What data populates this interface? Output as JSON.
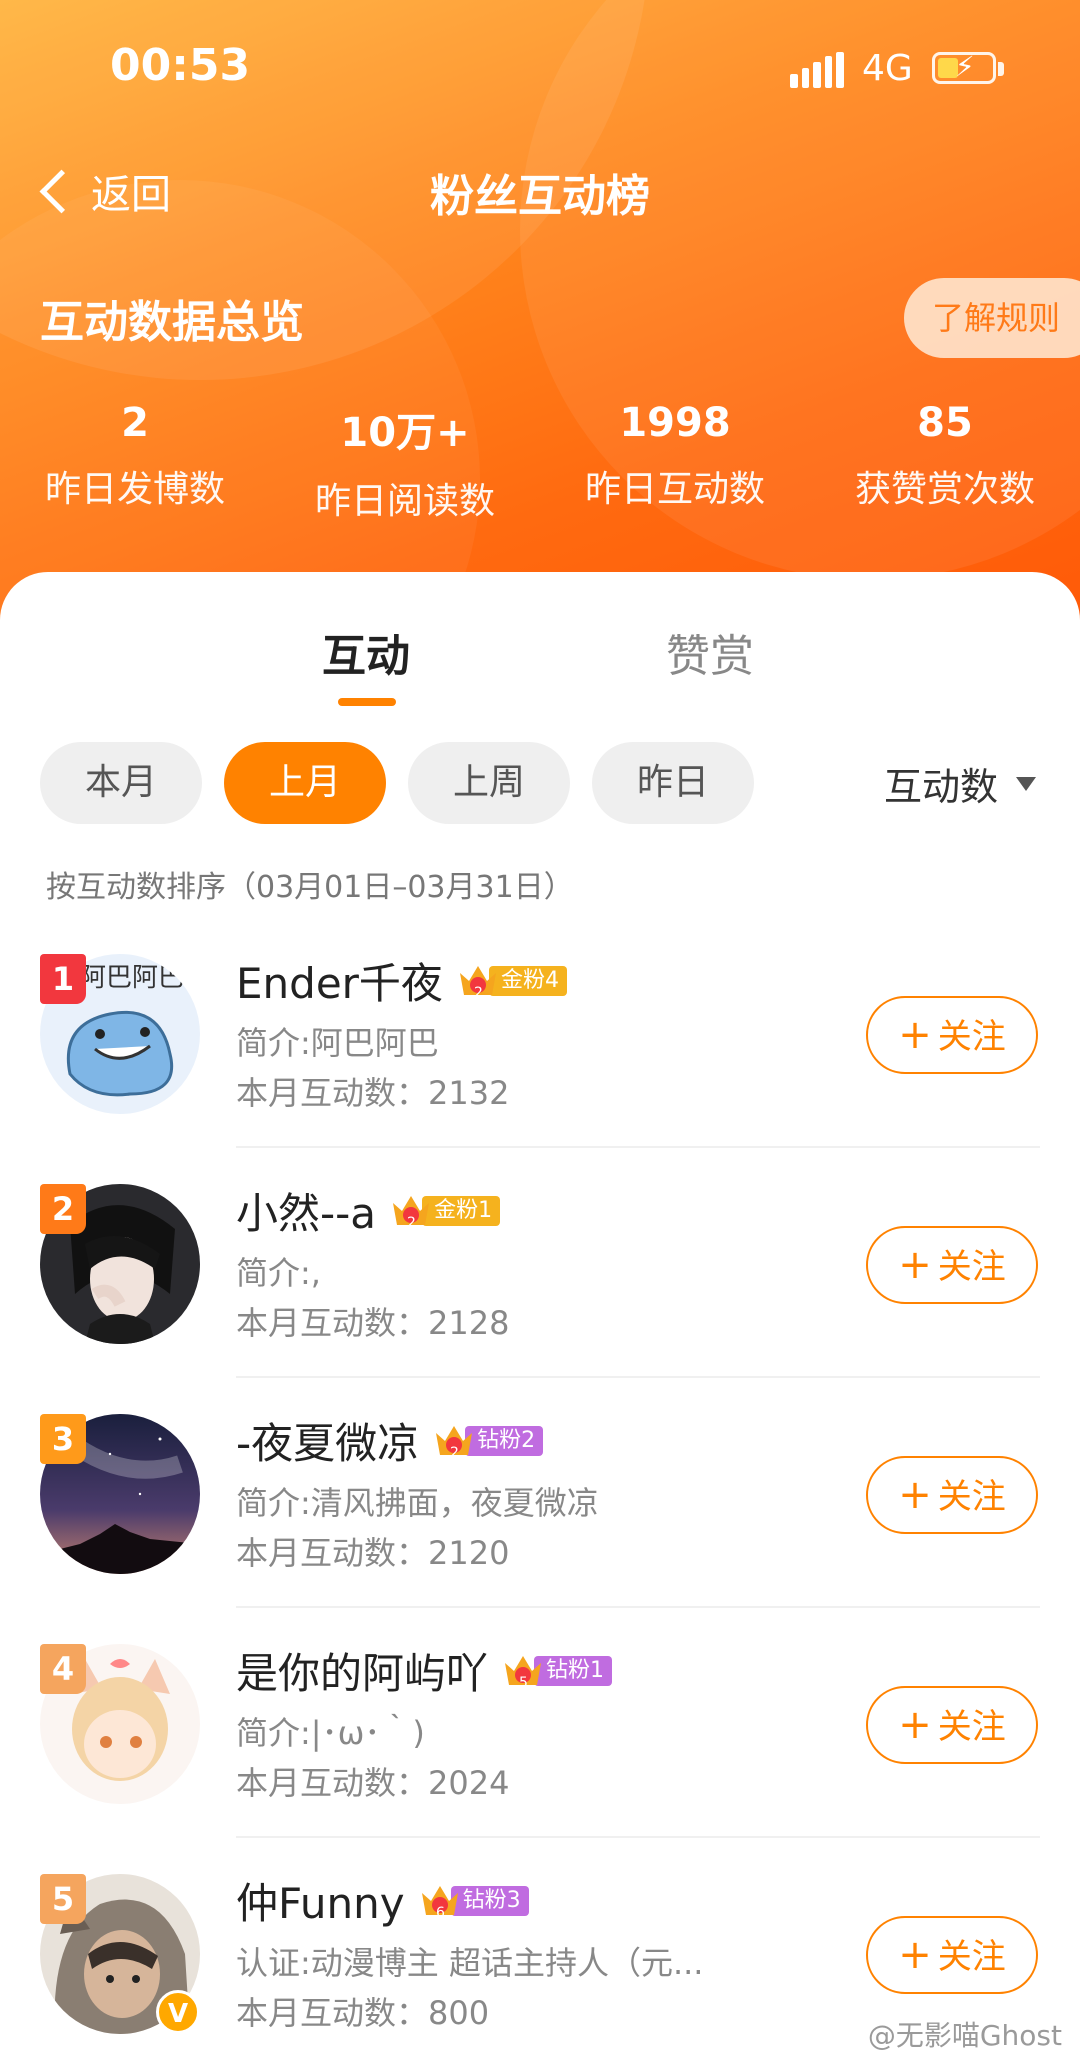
{
  "status_bar": {
    "time": "00:53",
    "network": "4G"
  },
  "nav": {
    "back_label": "返回",
    "title": "粉丝互动榜"
  },
  "overview": {
    "title": "互动数据总览",
    "rules_button": "了解规则",
    "stats": [
      {
        "value": "2",
        "label": "昨日发博数"
      },
      {
        "value": "10万+",
        "label": "昨日阅读数"
      },
      {
        "value": "1998",
        "label": "昨日互动数"
      },
      {
        "value": "85",
        "label": "获赞赏次数"
      }
    ]
  },
  "tabs": [
    {
      "label": "互动",
      "active": true
    },
    {
      "label": "赞赏",
      "active": false
    }
  ],
  "filters": [
    {
      "label": "本月",
      "active": false
    },
    {
      "label": "上月",
      "active": true
    },
    {
      "label": "上周",
      "active": false
    },
    {
      "label": "昨日",
      "active": false
    }
  ],
  "sort": {
    "label": "互动数"
  },
  "sort_description": "按互动数排序（03月01日–03月31日）",
  "fans": [
    {
      "rank": "1",
      "name": "Ender千夜",
      "level": "2",
      "badge": "金粉4",
      "badge_color": "#f5b21e",
      "bio": "简介:阿巴阿巴",
      "count": "本月互动数：2132",
      "follow": "关注",
      "rank_color": "#f2373e"
    },
    {
      "rank": "2",
      "name": "小然--a",
      "level": "2",
      "badge": "金粉1",
      "badge_color": "#f5b21e",
      "bio": "简介:,",
      "count": "本月互动数：2128",
      "follow": "关注",
      "rank_color": "#ff7a18"
    },
    {
      "rank": "3",
      "name": "-夜夏微凉",
      "level": "2",
      "badge": "钻粉2",
      "badge_color": "#c06ce0",
      "bio": "简介:清风拂面，夜夏微凉",
      "count": "本月互动数：2120",
      "follow": "关注",
      "rank_color": "#ff9a1a"
    },
    {
      "rank": "4",
      "name": "是你的阿屿吖",
      "level": "5",
      "badge": "钻粉1",
      "badge_color": "#c06ce0",
      "bio": "简介:|･ω･｀)",
      "count": "本月互动数：2024",
      "follow": "关注",
      "rank_color": "#f5a55e"
    },
    {
      "rank": "5",
      "name": "仲Funny",
      "level": "6",
      "badge": "钻粉3",
      "badge_color": "#c06ce0",
      "bio": "认证:动漫博主 超话主持人（元...",
      "count": "本月互动数：800",
      "follow": "关注",
      "rank_color": "#f5a55e",
      "verified": "V"
    }
  ],
  "watermark": "@无影喵Ghost"
}
